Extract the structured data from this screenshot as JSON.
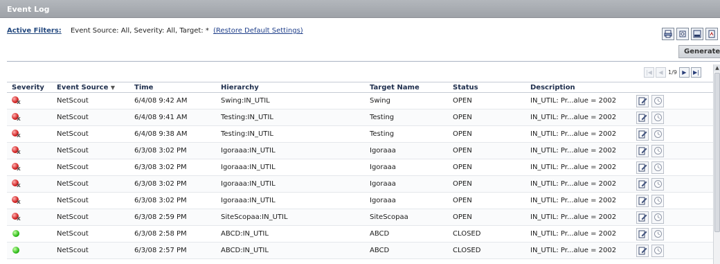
{
  "window": {
    "title": "Event Log"
  },
  "filters": {
    "label": "Active Filters:",
    "text": "Event Source: All, Severity: All, Target: *",
    "restore_link": "(Restore Default Settings)"
  },
  "toolbar": {
    "export_icons": [
      "print-icon",
      "printer-preview-icon",
      "export-csv-icon",
      "export-pdf-icon"
    ],
    "generate_label": "Generate"
  },
  "pager": {
    "info": "1/9"
  },
  "table": {
    "columns": [
      "Severity",
      "Event Source",
      "Time",
      "Hierarchy",
      "Target Name",
      "Status",
      "Description"
    ],
    "sort_indicator": "▼",
    "rows": [
      {
        "severity": "error",
        "source": "NetScout",
        "time": "6/4/08 9:42 AM",
        "hierarchy": "Swing:IN_UTIL",
        "target": "Swing",
        "status": "OPEN",
        "description": "IN_UTIL: Pr...alue = 2002"
      },
      {
        "severity": "error",
        "source": "NetScout",
        "time": "6/4/08 9:41 AM",
        "hierarchy": "Testing:IN_UTIL",
        "target": "Testing",
        "status": "OPEN",
        "description": "IN_UTIL: Pr...alue = 2002"
      },
      {
        "severity": "error",
        "source": "NetScout",
        "time": "6/4/08 9:38 AM",
        "hierarchy": "Testing:IN_UTIL",
        "target": "Testing",
        "status": "OPEN",
        "description": "IN_UTIL: Pr...alue = 2002"
      },
      {
        "severity": "error",
        "source": "NetScout",
        "time": "6/3/08 3:02 PM",
        "hierarchy": "Igoraaa:IN_UTIL",
        "target": "Igoraaa",
        "status": "OPEN",
        "description": "IN_UTIL: Pr...alue = 2002"
      },
      {
        "severity": "error",
        "source": "NetScout",
        "time": "6/3/08 3:02 PM",
        "hierarchy": "Igoraaa:IN_UTIL",
        "target": "Igoraaa",
        "status": "OPEN",
        "description": "IN_UTIL: Pr...alue = 2002"
      },
      {
        "severity": "error",
        "source": "NetScout",
        "time": "6/3/08 3:02 PM",
        "hierarchy": "Igoraaa:IN_UTIL",
        "target": "Igoraaa",
        "status": "OPEN",
        "description": "IN_UTIL: Pr...alue = 2002"
      },
      {
        "severity": "error",
        "source": "NetScout",
        "time": "6/3/08 3:02 PM",
        "hierarchy": "Igoraaa:IN_UTIL",
        "target": "Igoraaa",
        "status": "OPEN",
        "description": "IN_UTIL: Pr...alue = 2002"
      },
      {
        "severity": "error",
        "source": "NetScout",
        "time": "6/3/08 2:59 PM",
        "hierarchy": "SiteScopaa:IN_UTIL",
        "target": "SiteScopaa",
        "status": "OPEN",
        "description": "IN_UTIL: Pr...alue = 2002"
      },
      {
        "severity": "ok",
        "source": "NetScout",
        "time": "6/3/08 2:58 PM",
        "hierarchy": "ABCD:IN_UTIL",
        "target": "ABCD",
        "status": "CLOSED",
        "description": "IN_UTIL: Pr...alue = 2002"
      },
      {
        "severity": "ok",
        "source": "NetScout",
        "time": "6/3/08 2:57 PM",
        "hierarchy": "ABCD:IN_UTIL",
        "target": "ABCD",
        "status": "CLOSED",
        "description": "IN_UTIL: Pr...alue = 2002"
      }
    ],
    "row_actions": [
      "edit-event-icon",
      "event-history-icon"
    ]
  },
  "colors": {
    "title_bar": "#a3a7ad",
    "link": "#1f3f8a",
    "header_text": "#1e2e4d",
    "error": "#d02020",
    "ok": "#2fbd1a"
  }
}
